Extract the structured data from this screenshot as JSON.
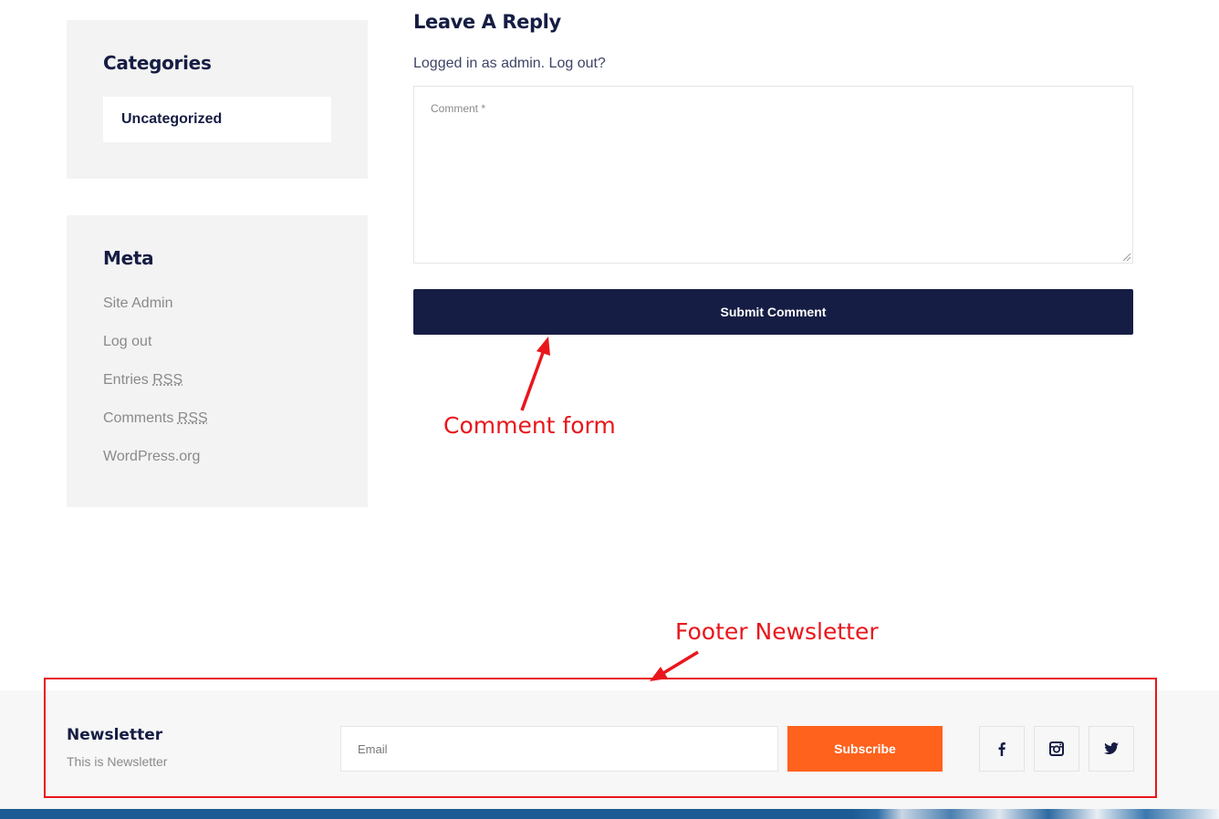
{
  "sidebar": {
    "categories": {
      "title": "Categories",
      "items": [
        "Uncategorized"
      ]
    },
    "meta": {
      "title": "Meta",
      "links": [
        {
          "pre": "Site Admin",
          "abbr": "",
          "post": ""
        },
        {
          "pre": "Log out",
          "abbr": "",
          "post": ""
        },
        {
          "pre": "Entries ",
          "abbr": "RSS",
          "post": ""
        },
        {
          "pre": "Comments ",
          "abbr": "RSS",
          "post": ""
        },
        {
          "pre": "WordPress.org",
          "abbr": "",
          "post": ""
        }
      ]
    }
  },
  "reply": {
    "title": "Leave A Reply",
    "logged_in_prefix": "Logged in as admin. ",
    "logout_link": "Log out?",
    "comment_placeholder": "Comment *",
    "submit_label": "Submit Comment"
  },
  "annotations": {
    "comment_form": "Comment form",
    "footer_newsletter": "Footer Newsletter",
    "color": "#e8161c"
  },
  "footer": {
    "newsletter_title": "Newsletter",
    "newsletter_subtitle": "This is Newsletter",
    "email_placeholder": "Email",
    "subscribe_label": "Subscribe",
    "social": [
      "facebook-icon",
      "instagram-icon",
      "twitter-icon"
    ]
  },
  "colors": {
    "primary_navy": "#161d44",
    "accent_orange": "#ff621d",
    "widget_bg": "#f3f3f3",
    "footer_bg": "#f7f7f7"
  }
}
